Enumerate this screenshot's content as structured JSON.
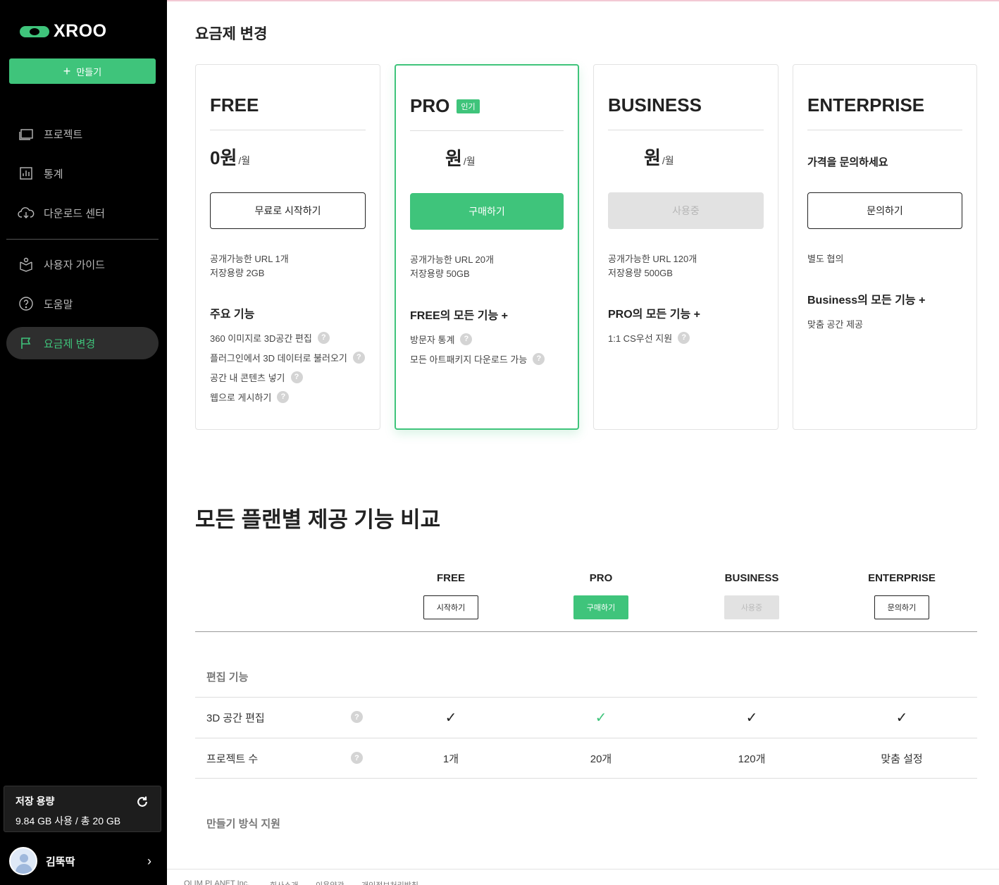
{
  "brand": {
    "name": "XROO",
    "accent": "#3fc47b"
  },
  "sidebar": {
    "create_label": "만들기",
    "items": [
      {
        "label": "프로젝트",
        "icon": "folder-icon"
      },
      {
        "label": "통계",
        "icon": "bar-chart-icon"
      },
      {
        "label": "다운로드 센터",
        "icon": "cloud-download-icon"
      },
      {
        "label": "사용자 가이드",
        "icon": "guide-icon"
      },
      {
        "label": "도움말",
        "icon": "help-circle-icon"
      },
      {
        "label": "요금제 변경",
        "icon": "flag-icon",
        "active": true
      }
    ],
    "storage": {
      "title": "저장 용량",
      "usage": "9.84 GB 사용 / 총 20 GB"
    },
    "user": {
      "name": "김뚝딱"
    }
  },
  "page": {
    "title": "요금제 변경"
  },
  "plans": [
    {
      "name": "FREE",
      "price": "0원",
      "per": "/월",
      "button": "무료로 시작하기",
      "limits": [
        "공개가능한 URL 1개",
        "저장용량 2GB"
      ],
      "features_title": "주요 기능",
      "features": [
        "360 이미지로 3D공간 편집",
        "플러그인에서 3D 데이터로 불러오기",
        "공간 내 콘텐츠 넣기",
        "웹으로 게시하기"
      ]
    },
    {
      "name": "PRO",
      "badge": "인기",
      "price": "원",
      "per": "/월",
      "button": "구매하기",
      "limits": [
        "공개가능한 URL 20개",
        "저장용량 50GB"
      ],
      "features_title": "FREE의 모든 기능 +",
      "features": [
        "방문자 통계",
        "모든 아트패키지 다운로드 가능"
      ]
    },
    {
      "name": "BUSINESS",
      "price": "원",
      "per": "/월",
      "button": "사용중",
      "limits": [
        "공개가능한 URL 120개",
        "저장용량 500GB"
      ],
      "features_title": "PRO의 모든 기능 +",
      "features": [
        "1:1 CS우선 지원"
      ]
    },
    {
      "name": "ENTERPRISE",
      "price_text": "가격을 문의하세요",
      "button": "문의하기",
      "limits": [
        "별도 협의"
      ],
      "features_title": "Business의 모든 기능 +",
      "features": [
        "맞춤 공간 제공"
      ]
    }
  ],
  "compare": {
    "title": "모든 플랜별 제공 기능 비교",
    "columns": [
      {
        "name": "FREE",
        "button": "시작하기"
      },
      {
        "name": "PRO",
        "button": "구매하기"
      },
      {
        "name": "BUSINESS",
        "button": "사용중"
      },
      {
        "name": "ENTERPRISE",
        "button": "문의하기"
      }
    ],
    "sections": [
      {
        "title": "편집 기능",
        "rows": [
          {
            "label": "3D 공간 편집",
            "values": [
              "✓",
              "✓",
              "✓",
              "✓"
            ]
          },
          {
            "label": "프로젝트 수",
            "values": [
              "1개",
              "20개",
              "120개",
              "맞춤 설정"
            ]
          }
        ]
      },
      {
        "title": "만들기 방식 지원",
        "rows": []
      }
    ]
  },
  "footer": {
    "company": "OLIM PLANET Inc.",
    "links": [
      "회사소개",
      "이용약관",
      "개인정보처리방침"
    ]
  }
}
